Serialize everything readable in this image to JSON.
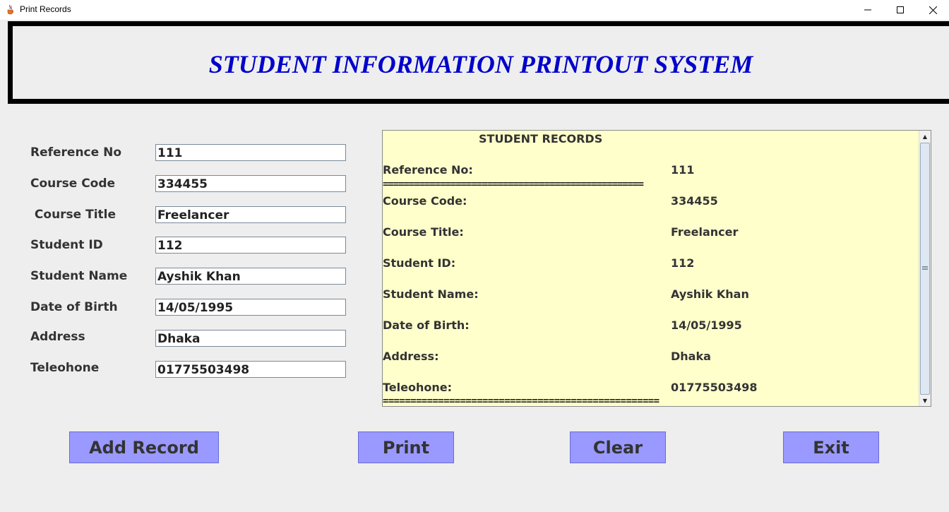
{
  "window": {
    "title": "Print Records",
    "icons": [
      "java-cup-icon",
      "minimize-icon",
      "maximize-icon",
      "close-icon"
    ]
  },
  "header": {
    "title": "STUDENT INFORMATION PRINTOUT SYSTEM",
    "title_color": "#0000cc"
  },
  "form": {
    "reference_no": {
      "label": "Reference No",
      "value": "111"
    },
    "course_code": {
      "label": "Course Code",
      "value": "334455"
    },
    "course_title": {
      "label": " Course Title",
      "value": "Freelancer"
    },
    "student_id": {
      "label": "Student ID",
      "value": "112"
    },
    "student_name": {
      "label": "Student Name",
      "value": "Ayshik Khan"
    },
    "date_of_birth": {
      "label": "Date of Birth",
      "value": "14/05/1995"
    },
    "address": {
      "label": "Address",
      "value": "Dhaka"
    },
    "telephone": {
      "label": "Teleohone",
      "value": "01775503498"
    }
  },
  "records": {
    "heading": "STUDENT RECORDS",
    "background": "#ffffcc",
    "separator": "==================================================",
    "rows": [
      {
        "label": "Reference No:",
        "value": "111"
      },
      {
        "label": "Course Code:",
        "value": "334455"
      },
      {
        "label": "Course Title:",
        "value": "Freelancer"
      },
      {
        "label": "Student ID:",
        "value": "112"
      },
      {
        "label": "Student Name:",
        "value": "Ayshik Khan"
      },
      {
        "label": "Date of Birth:",
        "value": "14/05/1995"
      },
      {
        "label": "Address:",
        "value": "Dhaka"
      },
      {
        "label": "Teleohone:",
        "value": "01775503498"
      }
    ]
  },
  "buttons": {
    "add_record": "Add Record",
    "print": "Print",
    "clear": "Clear",
    "exit": "Exit",
    "color": "#9999ff"
  }
}
